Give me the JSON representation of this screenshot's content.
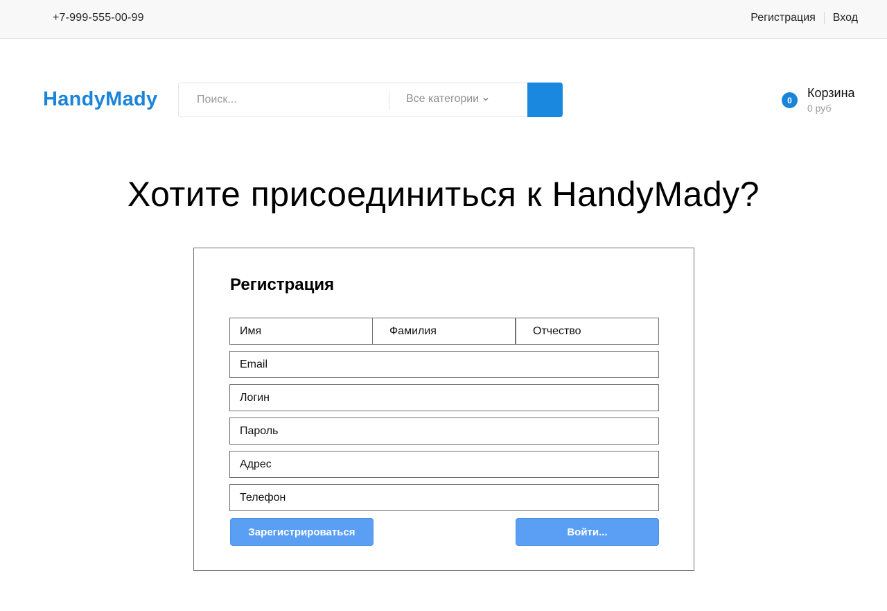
{
  "topbar": {
    "phone": "+7-999-555-00-99",
    "register_link": "Регистрация",
    "login_link": "Вход"
  },
  "header": {
    "logo": "HandyMady",
    "search": {
      "placeholder": "Поиск...",
      "category_label": "Все категории"
    },
    "cart": {
      "count": "0",
      "label": "Корзина",
      "total": "0 руб"
    }
  },
  "main": {
    "headline": "Хотите присоединиться к HandyMady?",
    "form": {
      "title": "Регистрация",
      "fields": {
        "first_name": "Имя",
        "last_name": "Фамилия",
        "patronymic": "Отчество",
        "email": "Email",
        "login": "Логин",
        "password": "Пароль",
        "address": "Адрес",
        "phone": "Телефон"
      },
      "register_button": "Зарегистрироваться",
      "login_button": "Войти..."
    }
  },
  "colors": {
    "brand": "#1a84d8",
    "button": "#5b9ff5"
  }
}
